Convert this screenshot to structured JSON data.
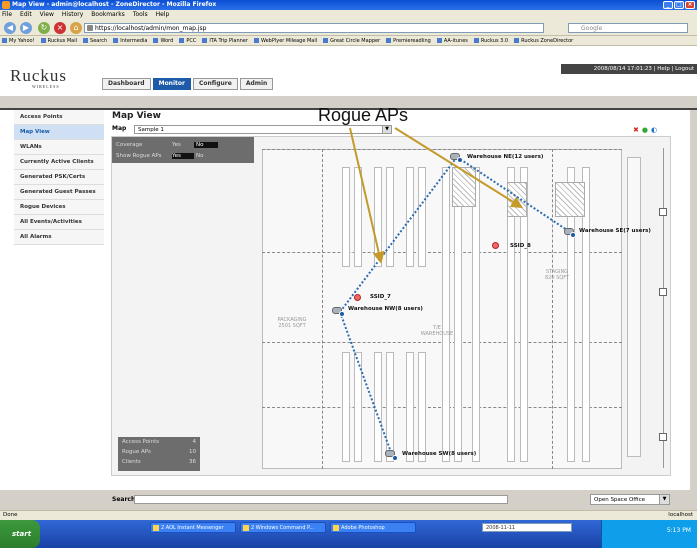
{
  "window": {
    "title": "Map View - admin@localhost - ZoneDirector - Mozilla Firefox",
    "controls": [
      "_",
      "□",
      "×"
    ]
  },
  "menu": [
    "File",
    "Edit",
    "View",
    "History",
    "Bookmarks",
    "Tools",
    "Help"
  ],
  "nav": {
    "url": "https://localhost/admin/mon_map.jsp",
    "search_placeholder": "Google"
  },
  "bookmarks": [
    "My Yahoo!",
    "Ruckus Mail",
    "Search",
    "Intermedia",
    "Word",
    "PCC",
    "ITA Trip Planner",
    "WebPlyer Mileage Mall",
    "Great Circle Mapper",
    "Premiereadling",
    "AA-itunes",
    "Ruckus 3.0",
    "Ruckus ZoneDirector"
  ],
  "app": {
    "logo": "Ruckus",
    "logo_sub": "WIRELESS",
    "date_bar": "2008/08/14 17:01:23  |  Help  |  Logout",
    "tabs": [
      "Dashboard",
      "Monitor",
      "Configure",
      "Admin"
    ],
    "active_tab": 1
  },
  "sidebar": {
    "items": [
      "Access Points",
      "Map View",
      "WLANs",
      "Currently Active Clients",
      "Generated PSK/Certs",
      "Generated Guest Passes",
      "Rogue Devices",
      "All Events/Activities",
      "All Alarms"
    ],
    "active": 1
  },
  "map": {
    "title": "Map View",
    "map_label": "Map",
    "map_select": "Sample 1",
    "toggles": [
      {
        "label": "Coverage",
        "yes": "Yes",
        "no": "No"
      },
      {
        "label": "Show Rogue APs",
        "yes": "Yes",
        "no": "No"
      }
    ],
    "legend": [
      {
        "label": "Access Points",
        "value": "4"
      },
      {
        "label": "Rogue APs",
        "value": "10"
      },
      {
        "label": "Clients",
        "value": "36"
      }
    ],
    "aps": [
      {
        "label": "Warehouse NE(12 users)"
      },
      {
        "label": "Warehouse SE(7 users)"
      },
      {
        "label": "Warehouse NW(8 users)"
      },
      {
        "label": "Warehouse SW(8 users)"
      }
    ],
    "rogues": [
      "SSID_8",
      "SSID_7"
    ],
    "zones": [
      {
        "text": "PACKAGING\n2501 SQFT"
      },
      {
        "text": "STAGING\n820 SQFT"
      },
      {
        "text": "T/E\nWAREHOUSE"
      }
    ],
    "search_label": "Search",
    "open_space_select": "Open Space Office"
  },
  "annotation": "Rogue APs",
  "status": {
    "left": "Done",
    "right": "localhost"
  },
  "taskbar": {
    "start": "start",
    "tasks": [
      "2 AOL Instant Messenger",
      "2 Windows Command P...",
      "Adobe Photoshop"
    ],
    "date_input": "2008-11-11",
    "clock": "5:13 PM"
  },
  "colors": {
    "accent": "#1d5aa8",
    "connection": "#2b6cb0",
    "arrow": "#c49a2a",
    "rogue": "#e66666"
  }
}
